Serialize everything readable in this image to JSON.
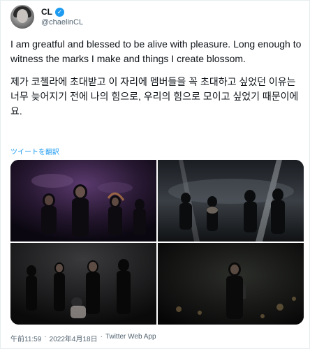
{
  "author": {
    "display_name": "CL",
    "handle": "@chaelinCL",
    "verified_icon": "verified-badge-icon"
  },
  "tweet": {
    "text_en": "I am greatful and blessed to be alive with pleasure. Long enough to witness the marks I make and things I create blossom.",
    "text_ko": "제가 코첼라에 초대받고 이 자리에 멤버들을 꼭 초대하고 싶었던 이유는 너무 늦어지기 전에 나의 힘으로, 우리의 힘으로 모이고 싶었기 때문이에요.",
    "translate_label": "ツイートを翻訳"
  },
  "media": [
    {
      "label": "stage-photo-1"
    },
    {
      "label": "stage-photo-2"
    },
    {
      "label": "stage-photo-3"
    },
    {
      "label": "stage-photo-4"
    }
  ],
  "meta": {
    "time": "午前11:59",
    "separator1": "·",
    "date": "2022年4月18日",
    "separator2": "·",
    "source": "Twitter Web App"
  },
  "colors": {
    "link": "#1d9bf0",
    "secondary_text": "#536471",
    "primary_text": "#0f1419"
  }
}
